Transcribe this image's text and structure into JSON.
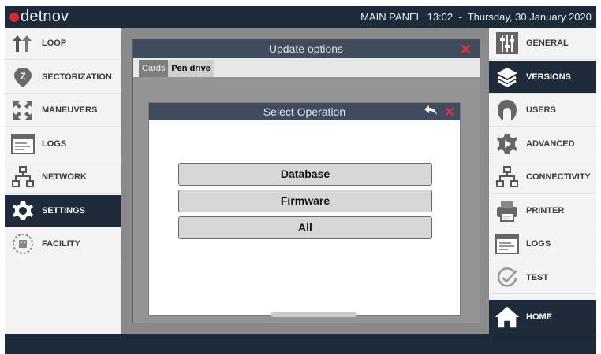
{
  "header": {
    "logo_text": "detnov",
    "status": "MAIN PANEL  13:02  -  Thursday, 30 January 2020"
  },
  "left_nav": [
    {
      "label": "LOOP",
      "icon": "loop-arrows-icon",
      "active": false
    },
    {
      "label": "SECTORIZATION",
      "icon": "sector-pin-icon",
      "active": false
    },
    {
      "label": "MANEUVERS",
      "icon": "expand-arrows-icon",
      "active": false
    },
    {
      "label": "LOGS",
      "icon": "log-window-icon",
      "active": false
    },
    {
      "label": "NETWORK",
      "icon": "network-icon",
      "active": false
    },
    {
      "label": "SETTINGS",
      "icon": "gear-icon",
      "active": true
    },
    {
      "label": "FACILITY",
      "icon": "building-icon",
      "active": false
    }
  ],
  "right_nav": [
    {
      "label": "GENERAL",
      "icon": "sliders-icon",
      "active": false
    },
    {
      "label": "VERSIONS",
      "icon": "layers-icon",
      "active": true
    },
    {
      "label": "USERS",
      "icon": "user-icon",
      "active": false
    },
    {
      "label": "ADVANCED",
      "icon": "advanced-gear-icon",
      "active": false
    },
    {
      "label": "CONNECTIVITY",
      "icon": "connectivity-icon",
      "active": false
    },
    {
      "label": "PRINTER",
      "icon": "printer-icon",
      "active": false
    },
    {
      "label": "LOGS",
      "icon": "log-window-icon",
      "active": false
    },
    {
      "label": "TEST",
      "icon": "check-circle-icon",
      "active": false
    }
  ],
  "home": {
    "label": "HOME",
    "icon": "home-icon"
  },
  "update_dialog": {
    "title": "Update options",
    "tabs": [
      {
        "label": "Cards",
        "active": false
      },
      {
        "label": "Pen drive",
        "active": true
      }
    ]
  },
  "select_dialog": {
    "title": "Select Operation",
    "options": [
      "Database",
      "Firmware",
      "All"
    ]
  },
  "colors": {
    "accent_red": "#e0262b",
    "nav_active": "#1f2b3b",
    "title_bar": "#3e4c5e"
  }
}
